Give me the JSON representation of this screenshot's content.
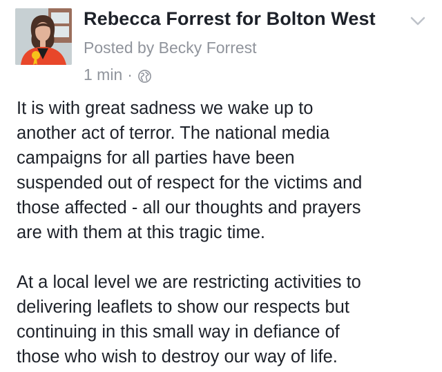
{
  "post": {
    "page_name": "Rebecca Forrest for Bolton West",
    "posted_by": "Posted by Becky Forrest",
    "time": "1 min",
    "separator": "·",
    "privacy_icon": "globe-icon",
    "menu_icon": "chevron-down-icon",
    "avatar": "profile-photo",
    "paragraphs": [
      [
        "It is with great sadness we wake up to",
        "another act of terror. The national media",
        "campaigns for all parties have been",
        "suspended out of respect for the victims and",
        "those affected - all our thoughts and prayers",
        "are with them at this tragic time."
      ],
      [
        "At a local level we are restricting activities to",
        "delivering leaflets to show our respects but",
        "continuing in this small way in defiance of",
        "those who wish to destroy our way of life."
      ]
    ]
  },
  "colors": {
    "text": "#1d2129",
    "meta": "#90949c",
    "icon": "#bec2c9",
    "background": "#ffffff"
  }
}
